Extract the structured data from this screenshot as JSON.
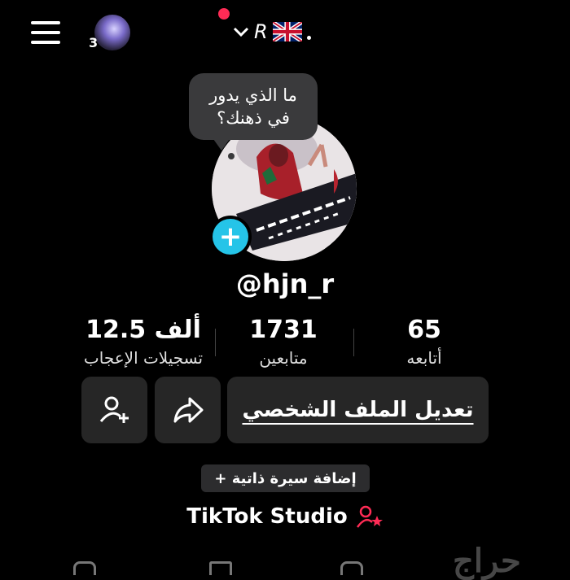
{
  "header": {
    "story_count": "3",
    "account_name": "R",
    "flag_icon": "uk-flag-icon"
  },
  "bubble": {
    "line1": "ما الذي يدور",
    "line2": "في ذهنك؟"
  },
  "profile": {
    "username": "@hjn_r"
  },
  "stats": {
    "likes_value": "12.5 ألف",
    "likes_label": "تسجيلات الإعجاب",
    "followers_value": "1731",
    "followers_label": "متابعين",
    "following_value": "65",
    "following_label": "أتابعه"
  },
  "actions": {
    "edit_profile": "تعديل الملف الشخصي",
    "add_bio": "+ إضافة سيرة ذاتية"
  },
  "studio": {
    "label": "TikTok Studio"
  },
  "watermark": {
    "text": "حراج"
  },
  "colors": {
    "background": "#000000",
    "accent_cyan": "#25c4e8",
    "accent_red": "#ff2b55",
    "button_bg": "#262626"
  }
}
